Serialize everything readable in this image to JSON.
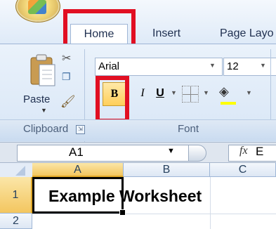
{
  "ribbon": {
    "tabs": [
      {
        "label": "Home"
      },
      {
        "label": "Insert"
      },
      {
        "label": "Page Layo"
      }
    ],
    "clipboard": {
      "paste_label": "Paste",
      "group_label": "Clipboard",
      "launcher_symbol": "⇲"
    },
    "font": {
      "name": "Arial",
      "size": "12",
      "bold_label": "B",
      "italic_label": "I",
      "underline_label": "U",
      "group_label": "Font"
    }
  },
  "formula_bar": {
    "cell_ref": "A1",
    "fx_label": "fx",
    "formula_text": "E"
  },
  "sheet": {
    "columns": [
      "A",
      "B",
      "C"
    ],
    "rows": [
      "1",
      "2"
    ],
    "cell_a1": "Example Worksheet"
  },
  "highlight_color": "#e10f22",
  "icons": [
    "office-button-icon",
    "paste-icon",
    "cut-icon",
    "copy-icon",
    "format-painter-icon",
    "borders-icon",
    "fill-color-icon"
  ]
}
